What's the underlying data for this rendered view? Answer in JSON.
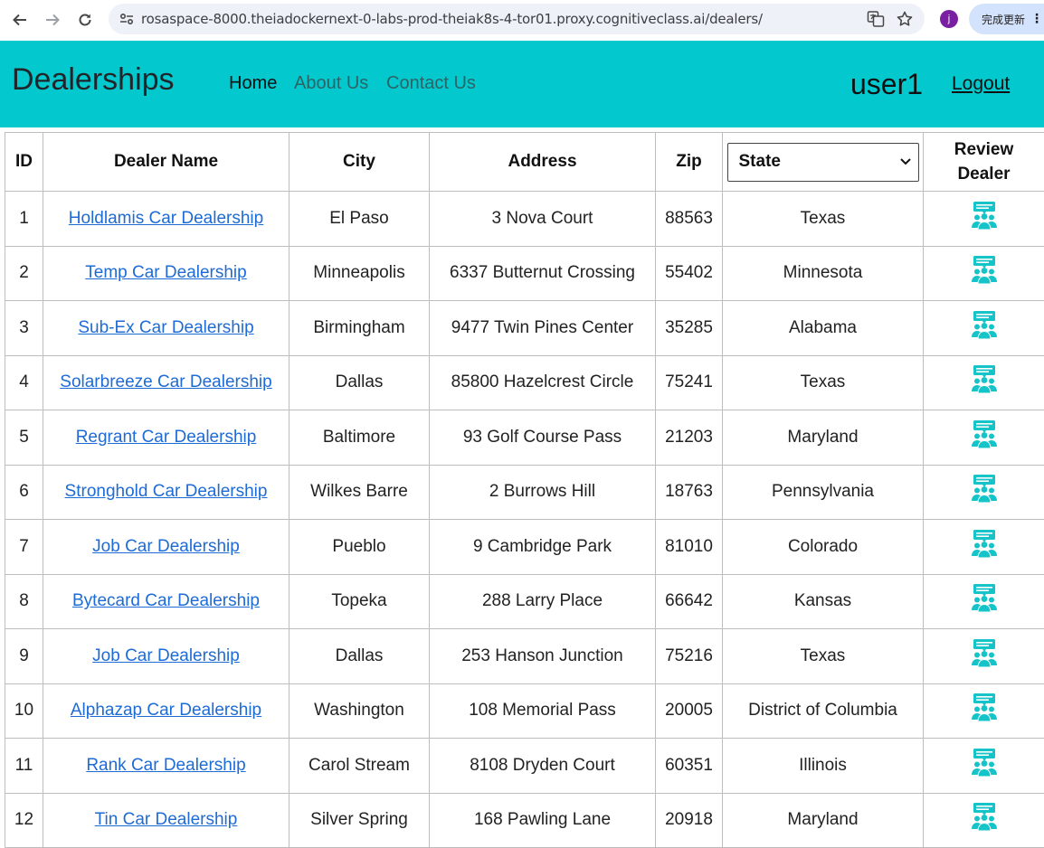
{
  "browser": {
    "url": "rosaspace-8000.theiadockernext-0-labs-prod-theiak8s-4-tor01.proxy.cognitiveclass.ai/dealers/",
    "profile_initial": "j",
    "update_label": "完成更新"
  },
  "navbar": {
    "brand": "Dealerships",
    "links": [
      {
        "label": "Home"
      },
      {
        "label": "About Us"
      },
      {
        "label": "Contact Us"
      }
    ],
    "username": "user1",
    "logout_label": "Logout",
    "bg_color": "#03c9cf"
  },
  "table": {
    "headers": {
      "id": "ID",
      "name": "Dealer Name",
      "city": "City",
      "address": "Address",
      "zip": "Zip",
      "state_select": "State",
      "review_line1": "Review",
      "review_line2": "Dealer"
    },
    "rows": [
      {
        "id": "1",
        "name": "Holdlamis Car Dealership",
        "city": "El Paso",
        "address": "3 Nova Court",
        "zip": "88563",
        "state": "Texas"
      },
      {
        "id": "2",
        "name": "Temp Car Dealership",
        "city": "Minneapolis",
        "address": "6337 Butternut Crossing",
        "zip": "55402",
        "state": "Minnesota"
      },
      {
        "id": "3",
        "name": "Sub-Ex Car Dealership",
        "city": "Birmingham",
        "address": "9477 Twin Pines Center",
        "zip": "35285",
        "state": "Alabama"
      },
      {
        "id": "4",
        "name": "Solarbreeze Car Dealership",
        "city": "Dallas",
        "address": "85800 Hazelcrest Circle",
        "zip": "75241",
        "state": "Texas"
      },
      {
        "id": "5",
        "name": "Regrant Car Dealership",
        "city": "Baltimore",
        "address": "93 Golf Course Pass",
        "zip": "21203",
        "state": "Maryland"
      },
      {
        "id": "6",
        "name": "Stronghold Car Dealership",
        "city": "Wilkes Barre",
        "address": "2 Burrows Hill",
        "zip": "18763",
        "state": "Pennsylvania"
      },
      {
        "id": "7",
        "name": "Job Car Dealership",
        "city": "Pueblo",
        "address": "9 Cambridge Park",
        "zip": "81010",
        "state": "Colorado"
      },
      {
        "id": "8",
        "name": "Bytecard Car Dealership",
        "city": "Topeka",
        "address": "288 Larry Place",
        "zip": "66642",
        "state": "Kansas"
      },
      {
        "id": "9",
        "name": "Job Car Dealership",
        "city": "Dallas",
        "address": "253 Hanson Junction",
        "zip": "75216",
        "state": "Texas"
      },
      {
        "id": "10",
        "name": "Alphazap Car Dealership",
        "city": "Washington",
        "address": "108 Memorial Pass",
        "zip": "20005",
        "state": "District of Columbia"
      },
      {
        "id": "11",
        "name": "Rank Car Dealership",
        "city": "Carol Stream",
        "address": "8108 Dryden Court",
        "zip": "60351",
        "state": "Illinois"
      },
      {
        "id": "12",
        "name": "Tin Car Dealership",
        "city": "Silver Spring",
        "address": "168 Pawling Lane",
        "zip": "20918",
        "state": "Maryland"
      }
    ],
    "review_icon": "review-dealer-icon",
    "link_color": "#1e6bd6",
    "icon_color": "#14c4c9"
  }
}
